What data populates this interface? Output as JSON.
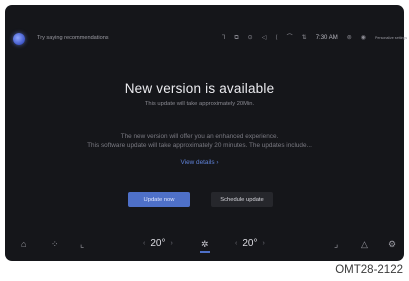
{
  "assistant": {
    "hint": "Try saying recommendations"
  },
  "status": {
    "icons": [
      "signal-icon",
      "screen-mirror-icon",
      "gps-icon",
      "mute-icon",
      "volume-icon",
      "wifi-icon",
      "connectivity-icon"
    ],
    "time": "7:30 AM",
    "profile_label": "Personalize settings"
  },
  "dialog": {
    "title": "New version is available",
    "subtitle": "This update will take approximately 20Min.",
    "description_line1": "The new version will offer you an enhanced experience.",
    "description_line2": "This software update will take approximately 20 minutes. The updates include...",
    "view_details": "View details",
    "primary_button": "Update now",
    "secondary_button": "Schedule update"
  },
  "bottom_bar": {
    "left_temp": "20°",
    "right_temp": "20°",
    "left_items": [
      "home-icon",
      "apps-icon",
      "seat-icon"
    ],
    "right_items": [
      "seat-heat-icon",
      "navigation-icon",
      "settings-icon"
    ]
  },
  "figure_caption": "OMT28-2122"
}
